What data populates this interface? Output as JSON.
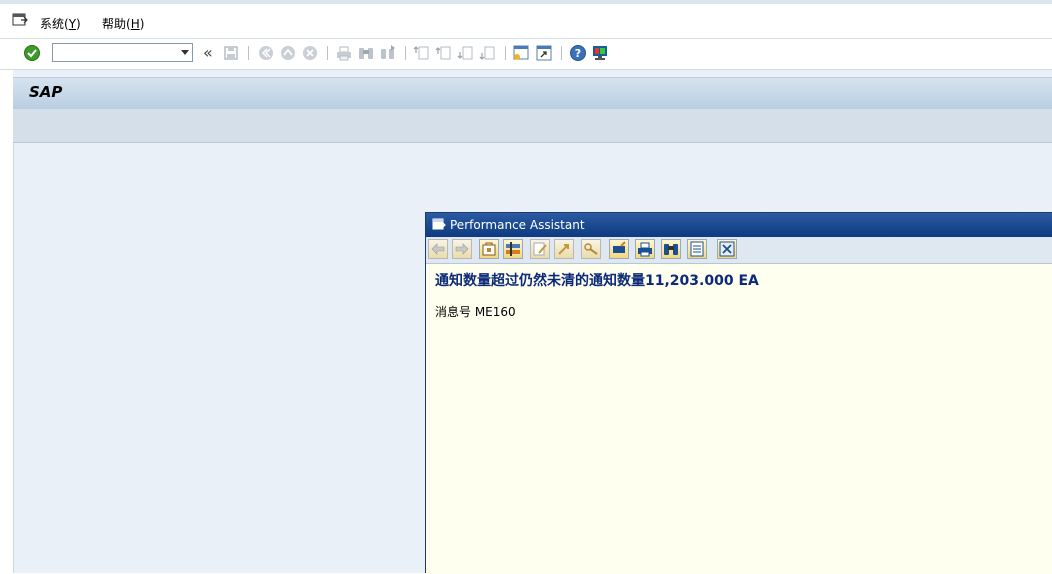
{
  "menu": {
    "items": [
      {
        "label": "系统",
        "hotkey": "(Y)",
        "hotkey_char": "Y"
      },
      {
        "label": "帮助",
        "hotkey": "(H)",
        "hotkey_char": "H"
      }
    ]
  },
  "toolbar": {
    "command_field_value": "",
    "expand_glyph": "«"
  },
  "screen": {
    "title": "SAP"
  },
  "dialog": {
    "title": "Performance Assistant",
    "message": "通知数量超过仍然未清的通知数量11,203.000 EA",
    "message_number": "消息号 ME160"
  },
  "colors": {
    "accent": "#0b2a78",
    "dialog_title_bg": "#0d3a80",
    "work_area_bg": "#eaf0f7",
    "dialog_bg": "#fffff0"
  }
}
